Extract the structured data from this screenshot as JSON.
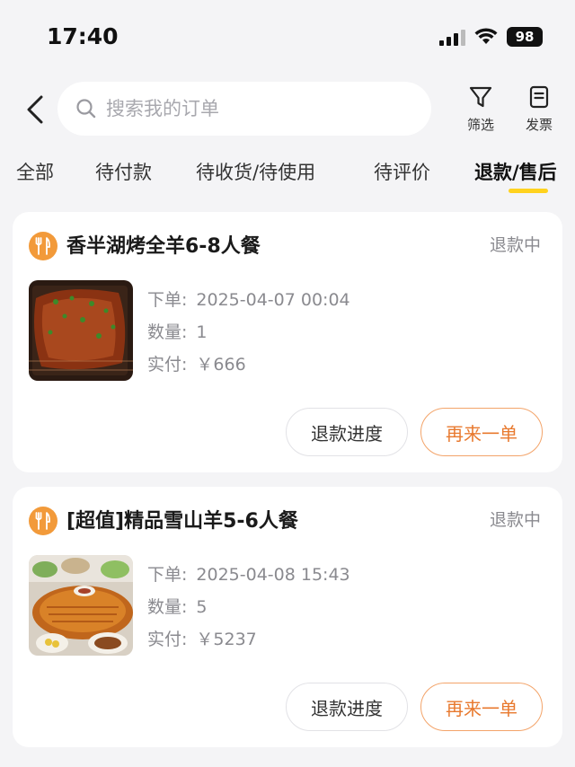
{
  "status_bar": {
    "time": "17:40",
    "battery": "98"
  },
  "search": {
    "placeholder": "搜索我的订单"
  },
  "actions": {
    "filter_label": "筛选",
    "invoice_label": "发票"
  },
  "tabs": [
    {
      "label": "全部"
    },
    {
      "label": "待付款"
    },
    {
      "label": "待收货/待使用"
    },
    {
      "label": "待评价"
    },
    {
      "label": "退款/售后",
      "active": true
    }
  ],
  "orders": [
    {
      "title": "香半湖烤全羊6-8人餐",
      "status": "退款中",
      "order_label": "下单:",
      "order_time": "2025-04-07 00:04",
      "qty_label": "数量:",
      "qty": "1",
      "paid_label": "实付:",
      "paid": "￥666",
      "refund_btn": "退款进度",
      "reorder_btn": "再来一单"
    },
    {
      "title": "[超值]精品雪山羊5-6人餐",
      "status": "退款中",
      "order_label": "下单:",
      "order_time": "2025-04-08 15:43",
      "qty_label": "数量:",
      "qty": "5",
      "paid_label": "实付:",
      "paid": "￥5237",
      "refund_btn": "退款进度",
      "reorder_btn": "再来一单"
    }
  ],
  "colors": {
    "accent": "#e8792e",
    "tab_underline": "#ffd21e",
    "icon_bg": "#f29a3a"
  }
}
